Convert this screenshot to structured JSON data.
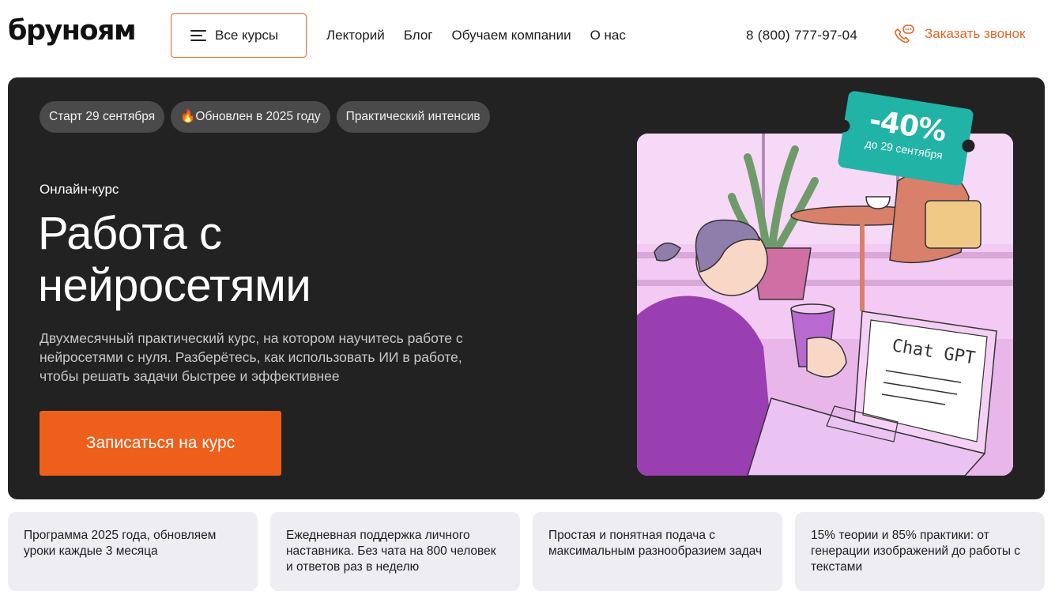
{
  "header": {
    "logo": "бруноям",
    "all_courses_label": "Все курсы",
    "nav": [
      {
        "label": "Лекторий"
      },
      {
        "label": "Блог"
      },
      {
        "label": "Обучаем компании"
      },
      {
        "label": "О нас"
      }
    ],
    "phone": "8 (800) 777-97-04",
    "callback_label": "Заказать звонок"
  },
  "hero": {
    "chips": [
      {
        "label": "Старт 29 сентября"
      },
      {
        "label": "🔥Обновлен в 2025 году"
      },
      {
        "label": "Практический интенсив"
      }
    ],
    "kind": "Онлайн-курс",
    "title_line1": "Работа с",
    "title_line2": "нейросетями",
    "description": "Двухмесячный практический курс, на котором научитесь работе с нейросетями с нуля. Разберётесь, как использовать ИИ в работе, чтобы решать задачи быстрее и эффективнее",
    "cta_label": "Записаться на курс",
    "discount": {
      "percent": "-40%",
      "until": "до 29 сентября"
    },
    "illustration_text": "Chat GPT"
  },
  "features": [
    {
      "text": "Программа 2025 года, обновляем уроки каждые 3 месяца"
    },
    {
      "text": "Ежедневная поддержка личного наставника. Без чата на 800 человек и ответов раз в неделю"
    },
    {
      "text": "Простая и понятная подача с максимальным разнообразием задач"
    },
    {
      "text": "15% теории и 85% практики: от генерации изображений до работы с текстами"
    }
  ],
  "colors": {
    "accent": "#ee5f1c",
    "hero_bg": "#222222",
    "badge": "#21b3a6",
    "feature_bg": "#eeeef2"
  }
}
